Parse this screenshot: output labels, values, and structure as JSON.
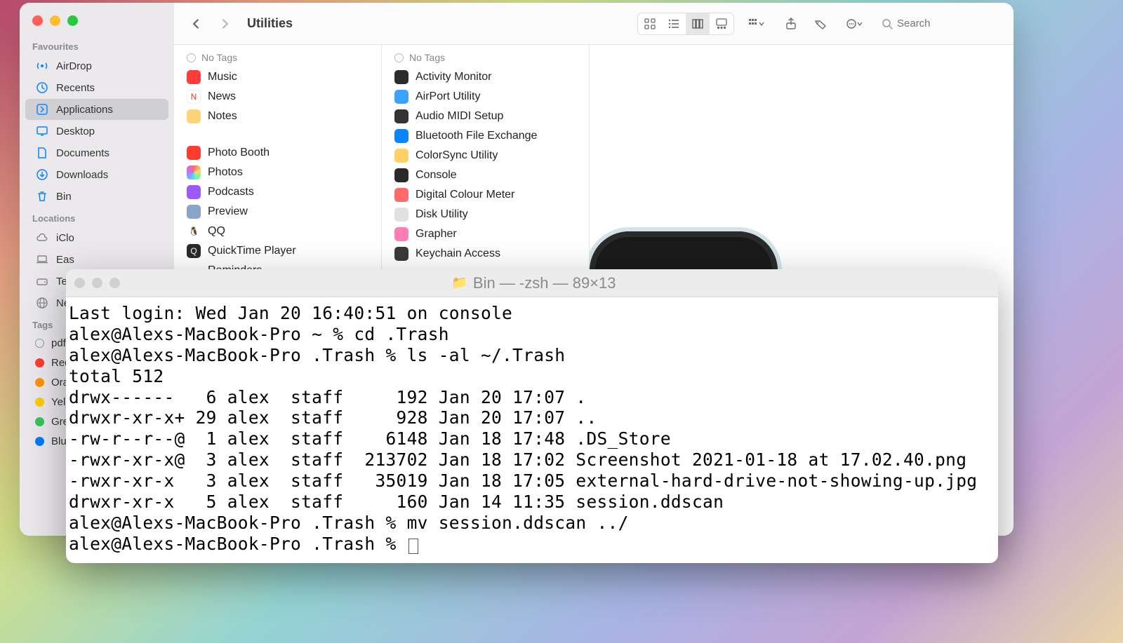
{
  "finder": {
    "title": "Utilities",
    "search_placeholder": "Search",
    "sidebar": {
      "heads": {
        "fav": "Favourites",
        "loc": "Locations",
        "tags": "Tags"
      },
      "fav": [
        {
          "label": "AirDrop",
          "icon": "airdrop"
        },
        {
          "label": "Recents",
          "icon": "clock"
        },
        {
          "label": "Applications",
          "icon": "app",
          "selected": true
        },
        {
          "label": "Desktop",
          "icon": "desktop"
        },
        {
          "label": "Documents",
          "icon": "doc"
        },
        {
          "label": "Downloads",
          "icon": "download"
        },
        {
          "label": "Bin",
          "icon": "bin"
        }
      ],
      "loc": [
        {
          "label": "iClo",
          "icon": "cloud"
        },
        {
          "label": "Eas",
          "icon": "laptop"
        },
        {
          "label": "Tes",
          "icon": "disk"
        },
        {
          "label": "Net",
          "icon": "globe"
        }
      ],
      "tags": [
        {
          "label": "pdf",
          "color": "none"
        },
        {
          "label": "Red",
          "color": "red"
        },
        {
          "label": "Ora",
          "color": "orange"
        },
        {
          "label": "Yell",
          "color": "yellow"
        },
        {
          "label": "Gre",
          "color": "green"
        },
        {
          "label": "Blu",
          "color": "blue"
        }
      ]
    },
    "col1": {
      "header": "No Tags",
      "itemsA": [
        {
          "label": "Music",
          "color": "#fc3d39"
        },
        {
          "label": "News",
          "color": "#ffffff",
          "txt": "#e03a3a",
          "glyph": "N"
        },
        {
          "label": "Notes",
          "color": "#ffd479"
        }
      ],
      "itemsB": [
        {
          "label": "Photo Booth",
          "color": "#ff3b30"
        },
        {
          "label": "Photos",
          "color": "#ffffff",
          "grad": true
        },
        {
          "label": "Podcasts",
          "color": "#9b59ff"
        },
        {
          "label": "Preview",
          "color": "#8aa4c8"
        },
        {
          "label": "QQ",
          "color": "#ffffff",
          "glyph": "🐧"
        },
        {
          "label": "QuickTime Player",
          "color": "#2a2a2a",
          "glyph": "Q"
        },
        {
          "label": "Reminders",
          "color": "#ffffff",
          "glyph": "⋮"
        }
      ]
    },
    "col2": {
      "header": "No Tags",
      "items": [
        {
          "label": "Activity Monitor",
          "color": "#2c2c2c"
        },
        {
          "label": "AirPort Utility",
          "color": "#3ba3ff"
        },
        {
          "label": "Audio MIDI Setup",
          "color": "#333333"
        },
        {
          "label": "Bluetooth File Exchange",
          "color": "#0a84ff"
        },
        {
          "label": "ColorSync Utility",
          "color": "#ffd166"
        },
        {
          "label": "Console",
          "color": "#2a2a2a"
        },
        {
          "label": "Digital Colour Meter",
          "color": "#ff6b6b"
        },
        {
          "label": "Disk Utility",
          "color": "#e0e0e0"
        },
        {
          "label": "Grapher",
          "color": "#ff7eb6"
        },
        {
          "label": "Keychain Access",
          "color": "#3a3a3a"
        }
      ]
    }
  },
  "terminal": {
    "title": "Bin — -zsh — 89×13",
    "lines": [
      "Last login: Wed Jan 20 16:40:51 on console",
      "alex@Alexs-MacBook-Pro ~ % cd .Trash",
      "alex@Alexs-MacBook-Pro .Trash % ls -al ~/.Trash",
      "total 512",
      "drwx------   6 alex  staff     192 Jan 20 17:07 .",
      "drwxr-xr-x+ 29 alex  staff     928 Jan 20 17:07 ..",
      "-rw-r--r--@  1 alex  staff    6148 Jan 18 17:48 .DS_Store",
      "-rwxr-xr-x@  3 alex  staff  213702 Jan 18 17:02 Screenshot 2021-01-18 at 17.02.40.png",
      "-rwxr-xr-x   3 alex  staff   35019 Jan 18 17:05 external-hard-drive-not-showing-up.jpg",
      "drwxr-xr-x   5 alex  staff     160 Jan 14 11:35 session.ddscan",
      "alex@Alexs-MacBook-Pro .Trash % mv session.ddscan ../",
      "alex@Alexs-MacBook-Pro .Trash % "
    ]
  }
}
